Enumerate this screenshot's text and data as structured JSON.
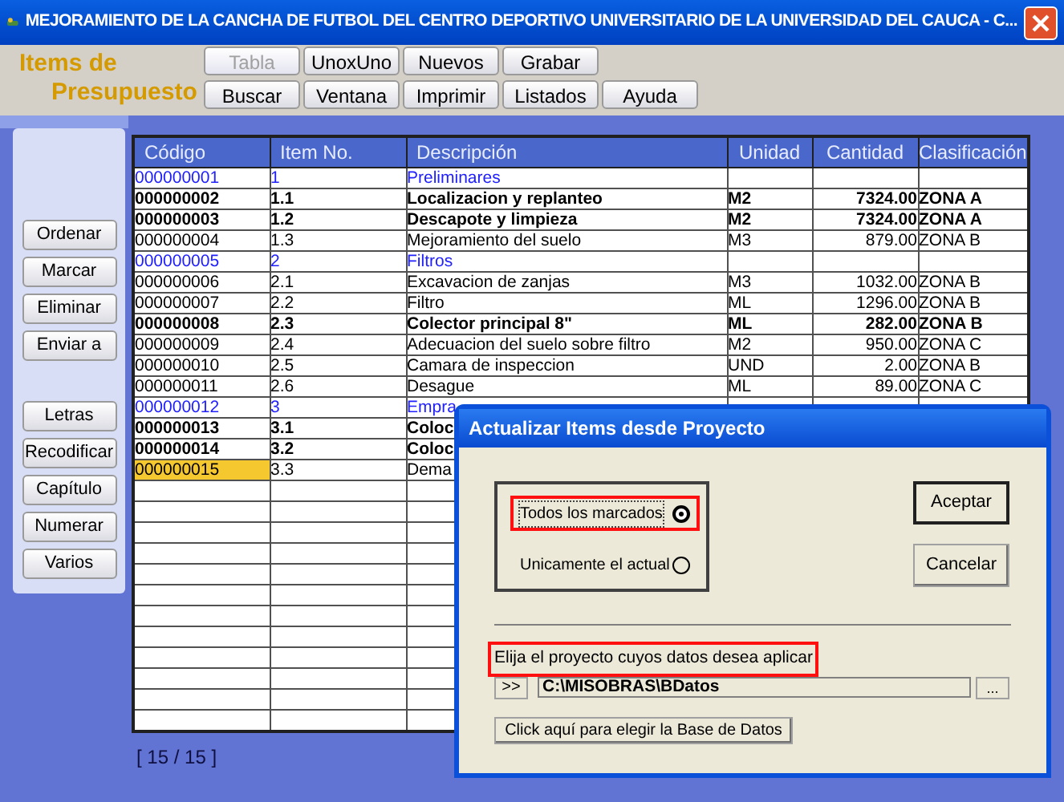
{
  "window": {
    "title": "MEJORAMIENTO DE LA CANCHA DE FUTBOL DEL CENTRO DEPORTIVO UNIVERSITARIO DE LA UNIVERSIDAD DEL CAUCA - C..."
  },
  "toolbar": {
    "title_lines": [
      "Items de",
      "Presupuesto"
    ],
    "button_rows": [
      [
        {
          "label": "Tabla",
          "disabled": true
        },
        {
          "label": "UnoxUno",
          "disabled": false
        },
        {
          "label": "Nuevos",
          "disabled": false
        },
        {
          "label": "Grabar",
          "disabled": false
        }
      ],
      [
        {
          "label": "Buscar",
          "disabled": false
        },
        {
          "label": "Ventana",
          "disabled": false
        },
        {
          "label": "Imprimir",
          "disabled": false
        },
        {
          "label": "Listados",
          "disabled": false
        },
        {
          "label": "Ayuda",
          "disabled": false
        }
      ]
    ]
  },
  "sidebar": {
    "groups": [
      [
        "Ordenar",
        "Marcar",
        "Eliminar",
        "Enviar a"
      ],
      [
        "Letras",
        "Recodificar",
        "Capítulo",
        "Numerar",
        "Varios"
      ]
    ]
  },
  "table": {
    "columns": [
      "Código",
      "Item No.",
      "Descripción",
      "Unidad",
      "Cantidad",
      "Clasificación"
    ],
    "rows": [
      {
        "kind": "chapter",
        "code": "000000001",
        "item": "1",
        "description": "Preliminares",
        "marked": false,
        "selected": false
      },
      {
        "kind": "item",
        "code": "000000002",
        "item": "1.1",
        "description": "Localizacion y replanteo",
        "unit": "M2",
        "quantity": "7324.00",
        "classification": "ZONA A",
        "marked": true,
        "selected": false
      },
      {
        "kind": "item",
        "code": "000000003",
        "item": "1.2",
        "description": "Descapote y limpieza",
        "unit": "M2",
        "quantity": "7324.00",
        "classification": "ZONA A",
        "marked": true,
        "selected": false
      },
      {
        "kind": "item",
        "code": "000000004",
        "item": "1.3",
        "description": "Mejoramiento del suelo",
        "unit": "M3",
        "quantity": "879.00",
        "classification": "ZONA B",
        "marked": false,
        "selected": false
      },
      {
        "kind": "chapter",
        "code": "000000005",
        "item": "2",
        "description": "Filtros",
        "marked": false,
        "selected": false
      },
      {
        "kind": "item",
        "code": "000000006",
        "item": "2.1",
        "description": "Excavacion de zanjas",
        "unit": "M3",
        "quantity": "1032.00",
        "classification": "ZONA B",
        "marked": false,
        "selected": false
      },
      {
        "kind": "item",
        "code": "000000007",
        "item": "2.2",
        "description": "Filtro",
        "unit": "ML",
        "quantity": "1296.00",
        "classification": "ZONA B",
        "marked": false,
        "selected": false
      },
      {
        "kind": "item",
        "code": "000000008",
        "item": "2.3",
        "description": "Colector principal 8\"",
        "unit": "ML",
        "quantity": "282.00",
        "classification": "ZONA B",
        "marked": true,
        "selected": false
      },
      {
        "kind": "item",
        "code": "000000009",
        "item": "2.4",
        "description": "Adecuacion del suelo sobre filtro",
        "unit": "M2",
        "quantity": "950.00",
        "classification": "ZONA C",
        "marked": false,
        "selected": false
      },
      {
        "kind": "item",
        "code": "000000010",
        "item": "2.5",
        "description": "Camara de inspeccion",
        "unit": "UND",
        "quantity": "2.00",
        "classification": "ZONA B",
        "marked": false,
        "selected": false
      },
      {
        "kind": "item",
        "code": "000000011",
        "item": "2.6",
        "description": "Desague",
        "unit": "ML",
        "quantity": "89.00",
        "classification": "ZONA C",
        "marked": false,
        "selected": false
      },
      {
        "kind": "chapter",
        "code": "000000012",
        "item": "3",
        "description": "Empra",
        "marked": false,
        "selected": false
      },
      {
        "kind": "item",
        "code": "000000013",
        "item": "3.1",
        "description": "Coloc",
        "marked": true,
        "selected": false
      },
      {
        "kind": "item",
        "code": "000000014",
        "item": "3.2",
        "description": "Coloc",
        "marked": true,
        "selected": false
      },
      {
        "kind": "item",
        "code": "000000015",
        "item": "3.3",
        "description": "Dema",
        "marked": false,
        "selected": true
      }
    ]
  },
  "status_bar": "[ 15 / 15 ]",
  "dialog": {
    "title": "Actualizar Items desde Proyecto",
    "options": [
      {
        "label": "Todos los marcados",
        "selected": true,
        "highlighted": true
      },
      {
        "label": "Unicamente el actual",
        "selected": false,
        "highlighted": false
      }
    ],
    "buttons": [
      {
        "label": "Aceptar",
        "default": true
      },
      {
        "label": "Cancelar",
        "default": false
      }
    ],
    "prompt": {
      "text": "Elija el proyecto cuyos datos desea aplicar",
      "highlighted": true
    },
    "browse_button": ">>",
    "path": "C:\\MISOBRAS\\BDatos",
    "ellipsis_button": "...",
    "database_button": "Click aquí para elegir la Base de Datos"
  }
}
